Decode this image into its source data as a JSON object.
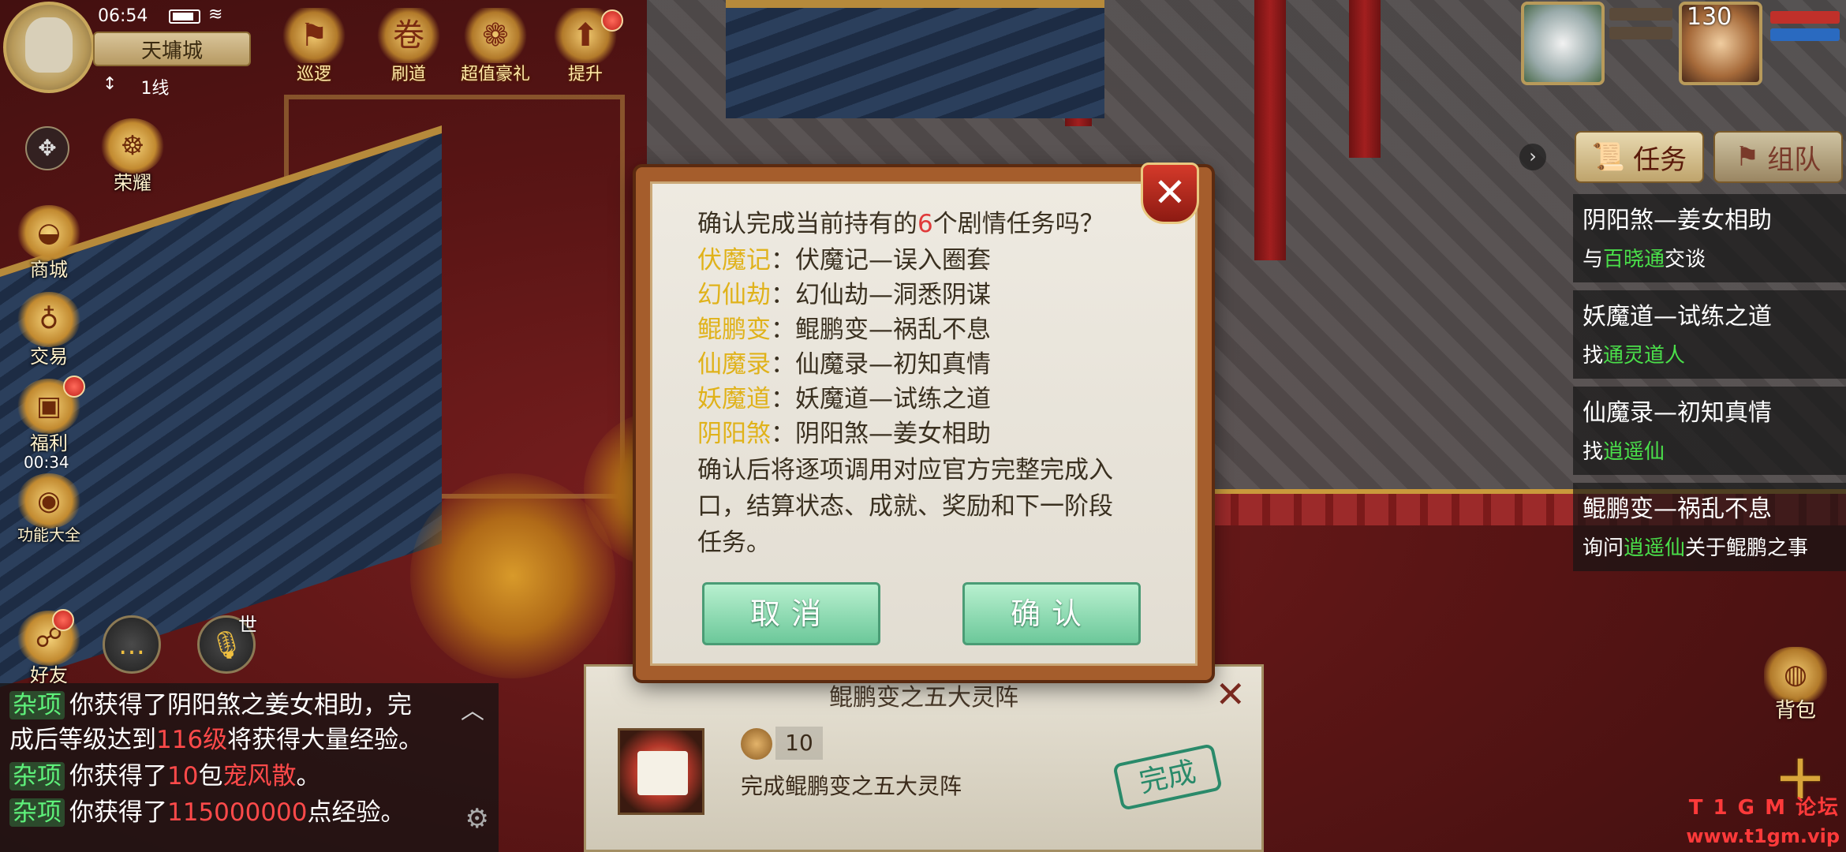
{
  "status_bar": {
    "time": "06:54"
  },
  "location": {
    "city": "天墉城",
    "line": "1线",
    "line_icon": "updown-arrow-icon"
  },
  "top_icons": [
    {
      "label": "巡逻",
      "icon": "flag-icon"
    },
    {
      "label": "刷道",
      "icon": "scroll-icon"
    },
    {
      "label": "超值豪礼",
      "icon": "gift-icon"
    },
    {
      "label": "提升",
      "icon": "up-arrow-icon"
    }
  ],
  "left_menu": [
    {
      "label": "荣耀",
      "icon": "badge-icon"
    },
    {
      "label": "商城",
      "icon": "ingot-icon"
    },
    {
      "label": "交易",
      "icon": "bag-icon"
    },
    {
      "label": "福利",
      "icon": "chest-icon"
    },
    {
      "label": "功能大全",
      "icon": "orb-icon"
    }
  ],
  "welfare_timer": "00:34",
  "social": {
    "friends_label": "好友",
    "voice_tag": "世"
  },
  "chat": {
    "tag": "杂项",
    "lines": [
      {
        "pre": "你获得了阴阳煞之姜女相助，完"
      },
      {
        "pre": "成后等级达到",
        "hl": "116级",
        "post": "将获得大量经验。"
      },
      {
        "pre": "你获得了",
        "num": "10",
        "mid": "包",
        "hl": "宠风散",
        "post": "。"
      },
      {
        "pre": "你获得了",
        "hl": "115000000",
        "post": "点经验。"
      }
    ]
  },
  "player": {
    "level": "130"
  },
  "task_panel": {
    "tab_task": "任务",
    "tab_team": "组队",
    "tasks": [
      {
        "title": "阴阳煞—姜女相助",
        "sub_pre": "与",
        "sub_hl": "百晓通",
        "sub_post": "交谈"
      },
      {
        "title": "妖魔道—试练之道",
        "sub_pre": "找",
        "sub_hl": "通灵道人",
        "sub_post": ""
      },
      {
        "title": "仙魔录—初知真情",
        "sub_pre": "找",
        "sub_hl": "逍遥仙",
        "sub_post": ""
      },
      {
        "title": "鲲鹏变—祸乱不息",
        "sub_pre": "询问",
        "sub_hl": "逍遥仙",
        "sub_post": "关于鲲鹏之事"
      }
    ]
  },
  "bag_label": "背包",
  "watermark": {
    "line1": "T 1 G M 论坛",
    "line2": "www.t1gm.vip"
  },
  "quest_banner": {
    "title": "鲲鹏变之五大灵阵",
    "reward_count": "10",
    "desc": "完成鲲鹏变之五大灵阵",
    "stamp": "完成"
  },
  "dialog": {
    "question_pre": "确认完成当前持有的",
    "question_count": "6",
    "question_post": "个剧情任务吗？",
    "items": [
      {
        "name": "伏魔记",
        "detail": "：伏魔记—误入圈套"
      },
      {
        "name": "幻仙劫",
        "detail": "：幻仙劫—洞悉阴谋"
      },
      {
        "name": "鲲鹏变",
        "detail": "：鲲鹏变—祸乱不息"
      },
      {
        "name": "仙魔录",
        "detail": "：仙魔录—初知真情"
      },
      {
        "name": "妖魔道",
        "detail": "：妖魔道—试练之道"
      },
      {
        "name": "阴阳煞",
        "detail": "：阴阳煞—姜女相助"
      }
    ],
    "note_1": "确认后将逐项调用对应官方完整完成入",
    "note_2": "口，结算状态、成就、奖励和下一阶段",
    "note_3": "任务。",
    "cancel_label": "取消",
    "confirm_label": "确认"
  }
}
